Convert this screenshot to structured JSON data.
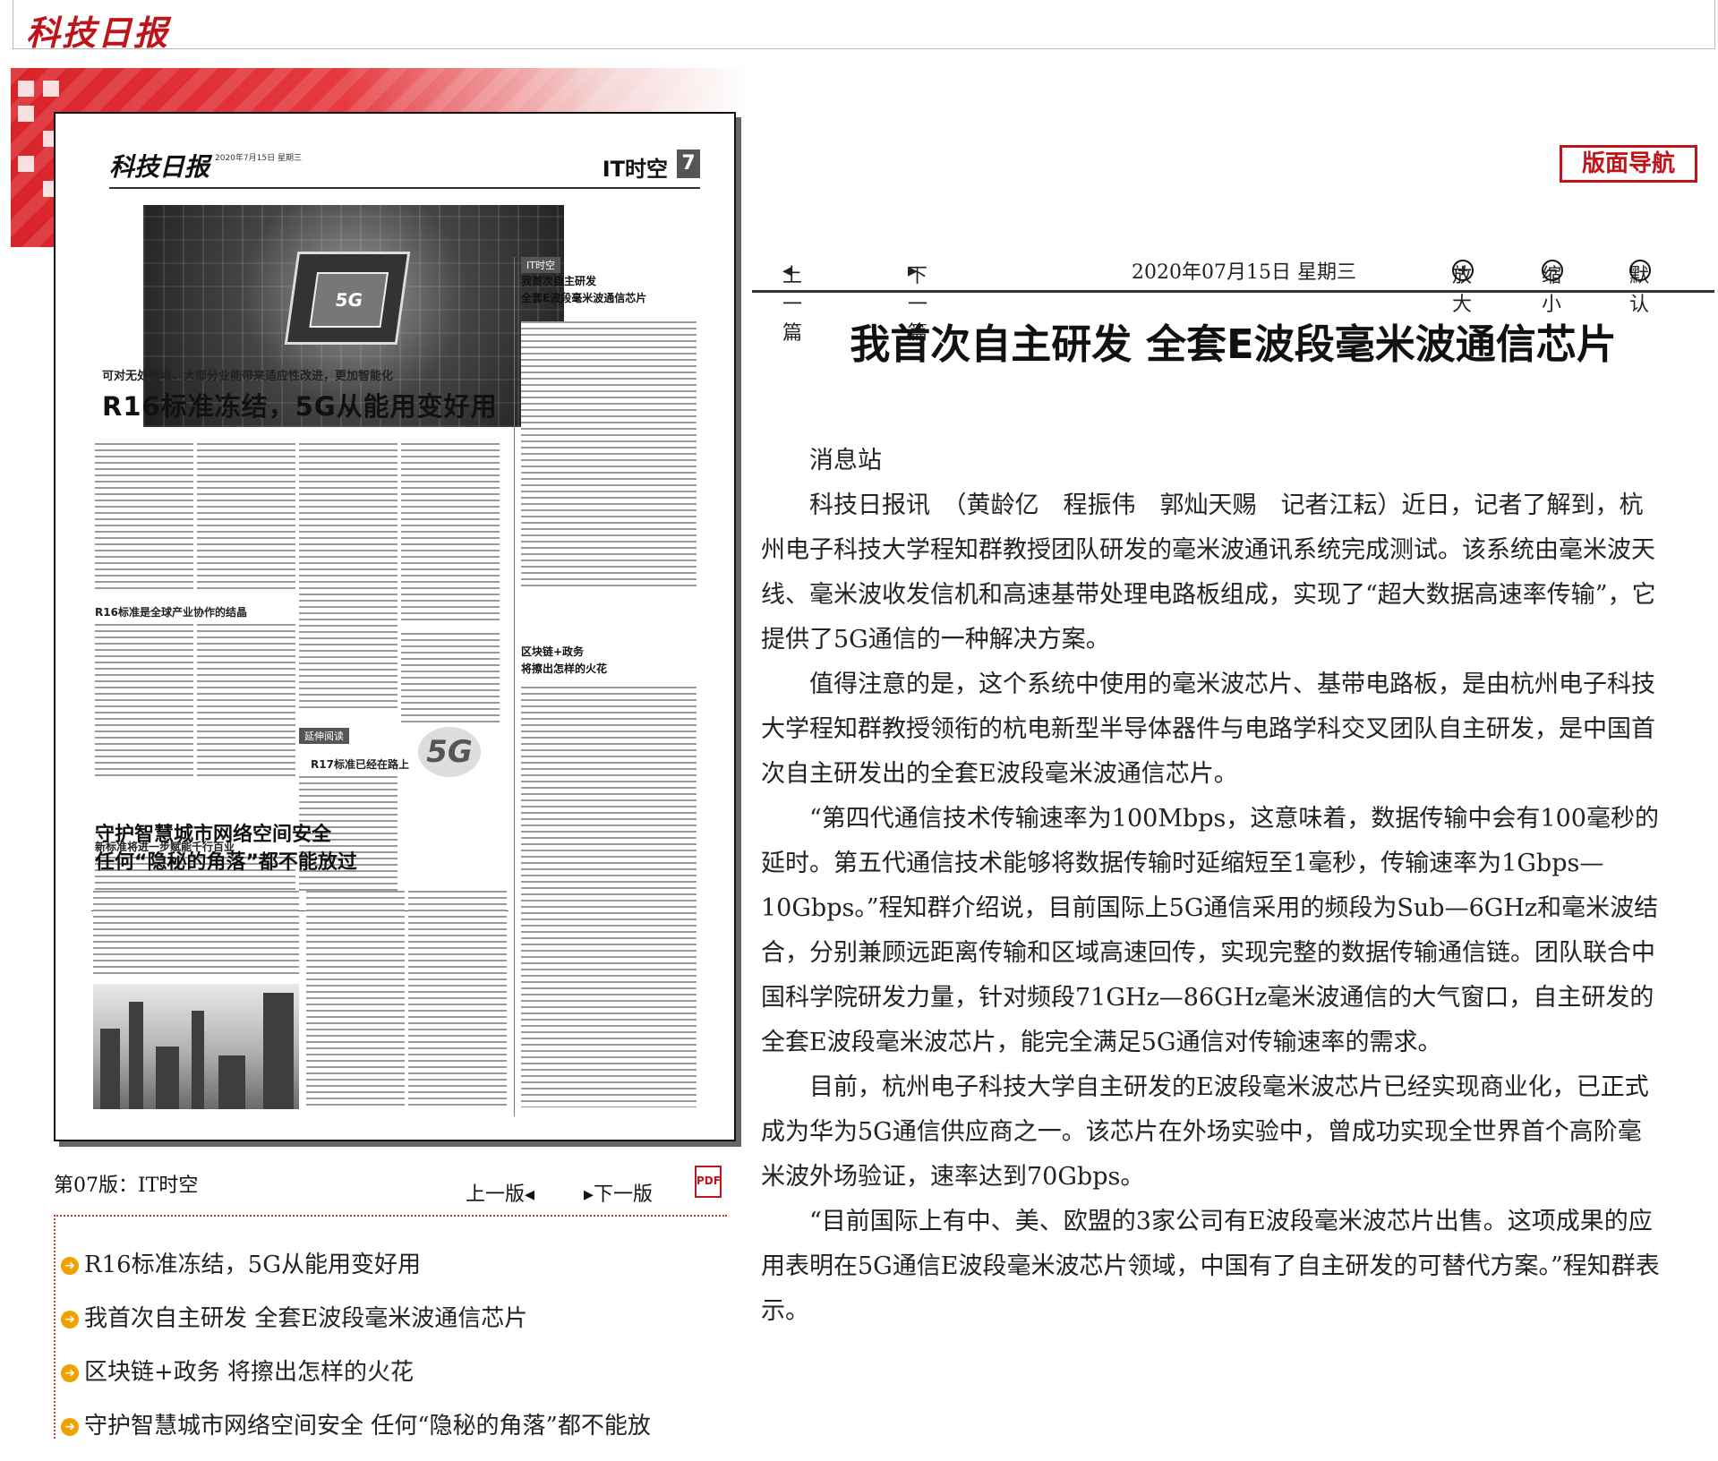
{
  "header": {
    "logo": "科技日报"
  },
  "paper_page": {
    "logo": "科技日报",
    "meta": "2020年7月15日 星期三",
    "section": "IT时空",
    "page_no": "7",
    "photo_label": "5G",
    "lead_deck": "可对无处围墙、大部分业能带来适应性改进，更加智能化",
    "lead_title": "R16标准冻结，5G从能用变好用",
    "sub1": "R16标准是全球产业协作的结晶",
    "tag1": "延伸阅读",
    "sub2": "R17标准已经在路上",
    "sub3": "新标准将进一步赋能千行百业",
    "badge5g": "5G",
    "right_title1": "我首次自主研发\n全套E波段毫米波通信芯片",
    "right_title2": "区块链+政务\n将擦出怎样的火花",
    "title2": "守护智慧城市网络空间安全\n任何“隐秘的角落”都不能放过"
  },
  "edition": {
    "label": "第07版：IT时空",
    "prev": "上一版",
    "next": "下一版",
    "pdf": "PDF"
  },
  "article_list": [
    "R16标准冻结，5G从能用变好用",
    "我首次自主研发 全套E波段毫米波通信芯片",
    "区块链+政务 将擦出怎样的火花",
    "守护智慧城市网络空间安全 任何“隐秘的角落”都不能放"
  ],
  "nav": {
    "button": "版面导航",
    "prev": "上一篇",
    "next": "下一篇",
    "date": "2020年07月15日 星期三",
    "zoom_in": "放大",
    "zoom_out": "缩小",
    "reset": "默认"
  },
  "article": {
    "title": "我首次自主研发 全套E波段毫米波通信芯片",
    "paragraphs": [
      "消息站",
      "科技日报讯　（黄龄亿　程振伟　郭灿天赐　记者江耘）近日，记者了解到，杭州电子科技大学程知群教授团队研发的毫米波通讯系统完成测试。该系统由毫米波天线、毫米波收发信机和高速基带处理电路板组成，实现了“超大数据高速率传输”，它提供了5G通信的一种解决方案。",
      "值得注意的是，这个系统中使用的毫米波芯片、基带电路板，是由杭州电子科技大学程知群教授领衔的杭电新型半导体器件与电路学科交叉团队自主研发，是中国首次自主研发出的全套E波段毫米波通信芯片。",
      "“第四代通信技术传输速率为100Mbps，这意味着，数据传输中会有100毫秒的延时。第五代通信技术能够将数据传输时延缩短至1毫秒，传输速率为1Gbps—10Gbps。”程知群介绍说，目前国际上5G通信采用的频段为Sub—6GHz和毫米波结合，分别兼顾远距离传输和区域高速回传，实现完整的数据传输通信链。团队联合中国科学院研发力量，针对频段71GHz—86GHz毫米波通信的大气窗口，自主研发的全套E波段毫米波芯片，能完全满足5G通信对传输速率的需求。",
      "目前，杭州电子科技大学自主研发的E波段毫米波芯片已经实现商业化，已正式成为华为5G通信供应商之一。该芯片在外场实验中，曾成功实现全世界首个高阶毫米波外场验证，速率达到70Gbps。",
      "“目前国际上有中、美、欧盟的3家公司有E波段毫米波芯片出售。这项成果的应用表明在5G通信E波段毫米波芯片领域，中国有了自主研发的可替代方案。”程知群表示。"
    ]
  }
}
